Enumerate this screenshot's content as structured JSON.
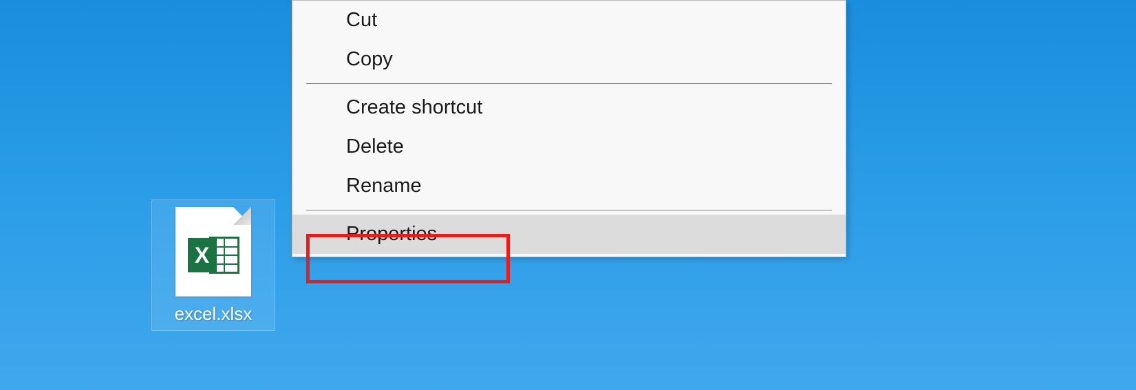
{
  "desktop": {
    "file": {
      "name": "excel.xlsx",
      "icon_letter": "X"
    }
  },
  "context_menu": {
    "items": [
      {
        "label": "Cut",
        "type": "item"
      },
      {
        "label": "Copy",
        "type": "item"
      },
      {
        "type": "separator"
      },
      {
        "label": "Create shortcut",
        "type": "item"
      },
      {
        "label": "Delete",
        "type": "item"
      },
      {
        "label": "Rename",
        "type": "item"
      },
      {
        "type": "separator"
      },
      {
        "label": "Properties",
        "type": "item",
        "highlighted": true,
        "annotated": true
      }
    ]
  }
}
